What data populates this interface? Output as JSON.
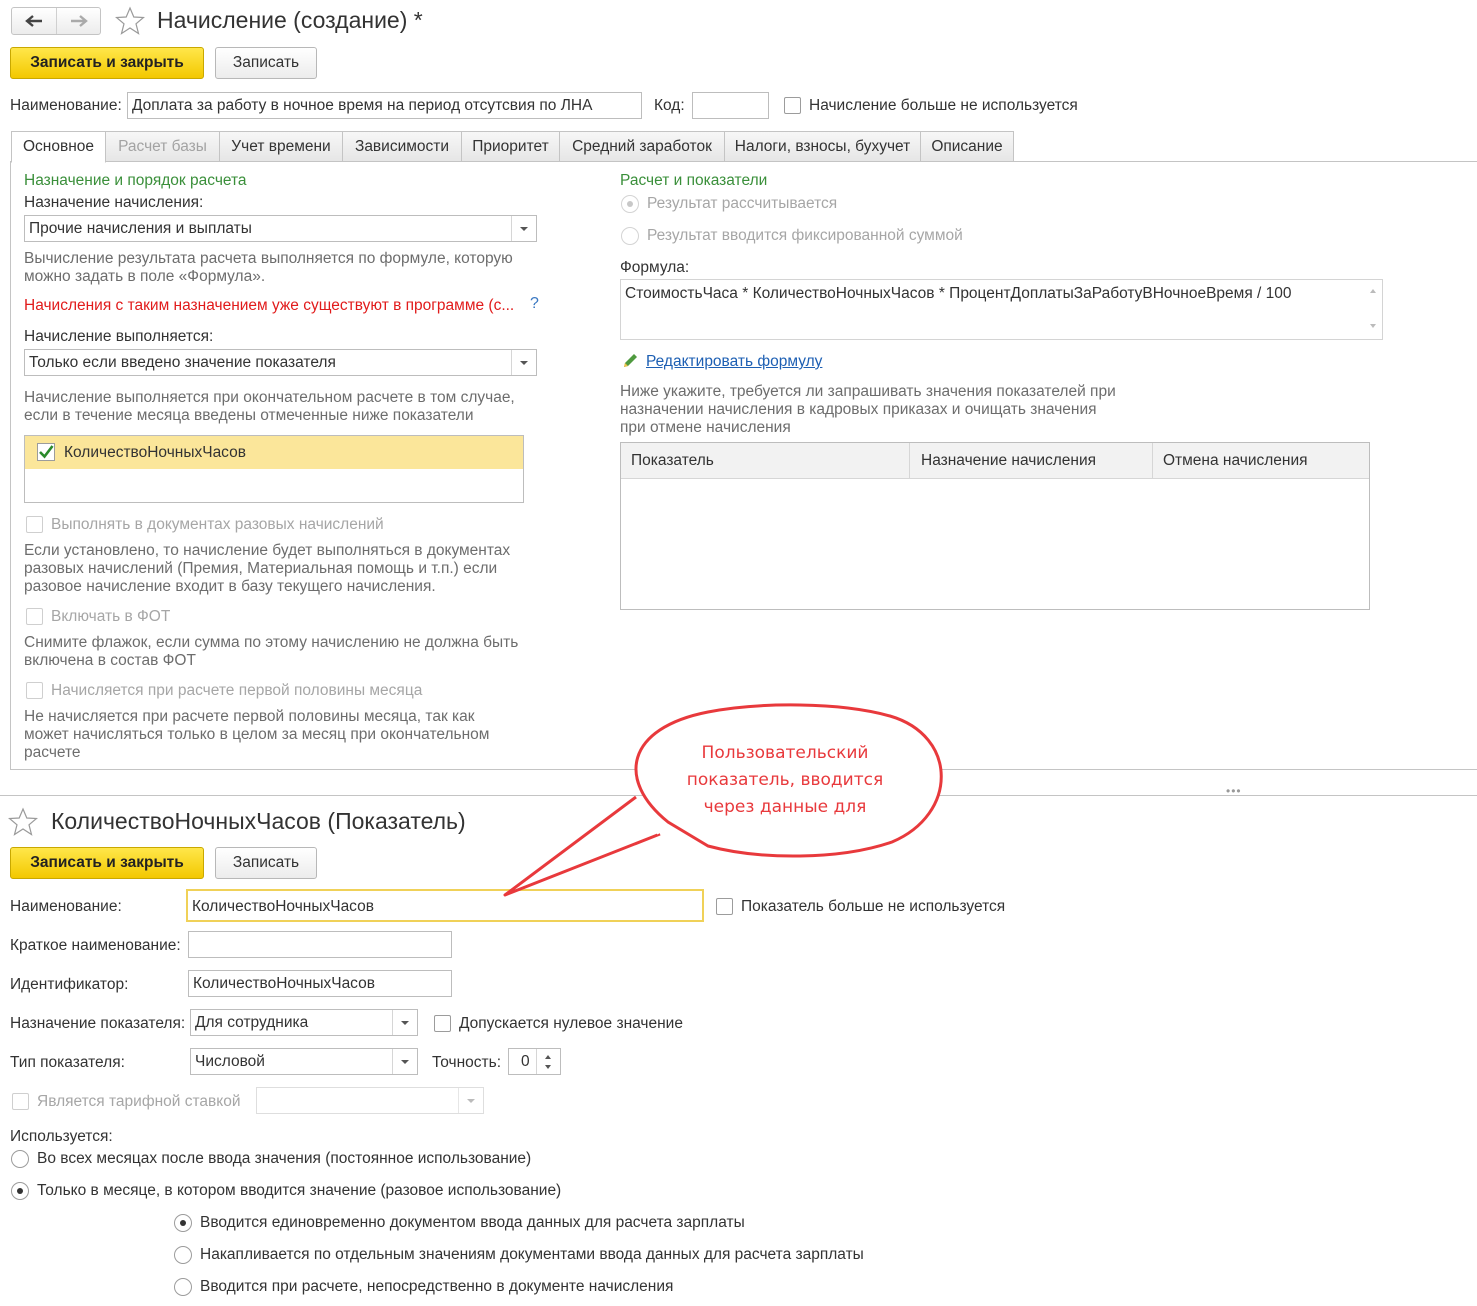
{
  "top": {
    "title": "Начисление (создание) *",
    "save_close": "Записать и закрыть",
    "save": "Записать",
    "name_label": "Наименование:",
    "name_value": "Доплата за работу в ночное время на период отсутсвия по ЛНА",
    "code_label": "Код:",
    "code_value": "",
    "not_used_label": "Начисление больше не используется",
    "tabs": [
      "Основное",
      "Расчет базы",
      "Учет времени",
      "Зависимости",
      "Приоритет",
      "Средний заработок",
      "Налоги, взносы, бухучет",
      "Описание"
    ]
  },
  "left": {
    "section_title": "Назначение и порядок расчета",
    "purpose_label": "Назначение начисления:",
    "purpose_value": "Прочие начисления и выплаты",
    "purpose_hint_1": "Вычисление результата расчета выполняется по формуле, которую",
    "purpose_hint_2": "можно задать в поле «Формула».",
    "warning": "Начисления с таким назначением уже существуют в программе (с...",
    "help": "?",
    "executed_label": "Начисление выполняется:",
    "executed_value": "Только если введено значение показателя",
    "executed_hint_1": "Начисление выполняется при окончательном расчете в том случае,",
    "executed_hint_2": "если в течение месяца введены отмеченные ниже показатели",
    "indicator_item": "КоличествоНочныхЧасов",
    "one_time_label": "Выполнять в документах разовых начислений",
    "one_time_hint_1": "Если установлено, то начисление будет выполняться в документах",
    "one_time_hint_2": "разовых начислений (Премия, Материальная помощь и т.п.) если",
    "one_time_hint_3": "разовое начисление входит в базу текущего начисления.",
    "fot_label": "Включать в ФОТ",
    "fot_hint_1": "Снимите флажок, если сумма по этому начислению не должна быть",
    "fot_hint_2": "включена в состав ФОТ",
    "half_label": "Начисляется при расчете первой половины месяца",
    "half_hint_1": "Не начисляется при расчете первой половины месяца, так как",
    "half_hint_2": "может начисляться только в целом за месяц при окончательном",
    "half_hint_3": "расчете"
  },
  "right": {
    "section_title": "Расчет и показатели",
    "radio_calc": "Результат рассчитывается",
    "radio_fixed": "Результат вводится фиксированной суммой",
    "formula_label": "Формула:",
    "formula_value": "СтоимостьЧаса * КоличествоНочныхЧасов * ПроцентДоплатыЗаРаботуВНочноеВремя / 100",
    "edit_formula": "Редактировать формулу",
    "request_hint_1": "Ниже укажите, требуется ли запрашивать значения показателей при",
    "request_hint_2": "назначении начисления в кадровых приказах и очищать значения",
    "request_hint_3": "при отмене начисления",
    "table_headers": [
      "Показатель",
      "Назначение начисления",
      "Отмена начисления"
    ]
  },
  "bottom": {
    "title": "КоличествоНочныхЧасов (Показатель)",
    "save_close": "Записать и закрыть",
    "save": "Записать",
    "name_label": "Наименование:",
    "name_value": "КоличествоНочныхЧасов",
    "not_used_label": "Показатель больше не используется",
    "short_label": "Краткое наименование:",
    "short_value": "",
    "id_label": "Идентификатор:",
    "id_value": "КоличествоНочныхЧасов",
    "purpose_label": "Назначение показателя:",
    "purpose_value": "Для сотрудника",
    "zero_label": "Допускается нулевое значение",
    "type_label": "Тип показателя:",
    "type_value": "Числовой",
    "precision_label": "Точность:",
    "precision_value": "0",
    "tariff_label": "Является тарифной ставкой",
    "used_label": "Используется:",
    "used_all": "Во всех месяцах после ввода значения (постоянное использование)",
    "used_once": "Только в месяце, в котором вводится значение (разовое использование)",
    "sub_1": "Вводится единовременно документом ввода данных для расчета зарплаты",
    "sub_2": "Накапливается по отдельным значениям документами ввода данных для расчета зарплаты",
    "sub_3": "Вводится при расчете, непосредственно в документе начисления"
  },
  "callout": {
    "line1": "Пользовательский",
    "line2": "показатель, вводится",
    "line3": "через данные для",
    "color": "#e8393c"
  }
}
